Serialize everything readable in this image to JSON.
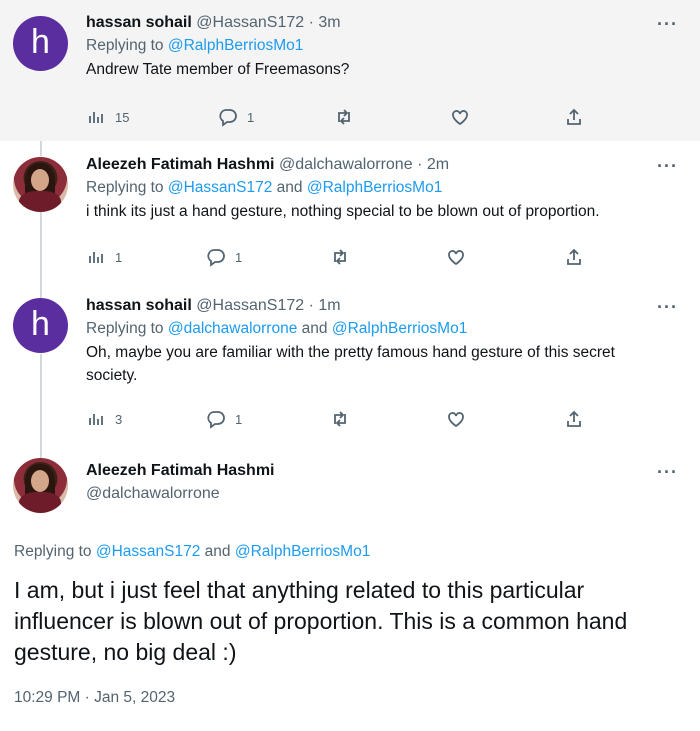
{
  "replies": [
    {
      "avatar_letter": "h",
      "name": "hassan sohail",
      "handle": "@HassanS172",
      "time": "· 3m",
      "replying_prefix": "Replying to ",
      "mentions": [
        "@RalphBerriosMo1"
      ],
      "mention_joiner": "",
      "text": "Andrew Tate member of Freemasons?",
      "stats": {
        "views": "15",
        "replies": "1",
        "retweets": "",
        "likes": ""
      }
    },
    {
      "avatar_letter": "",
      "name": "Aleezeh Fatimah Hashmi",
      "handle": "@dalchawalorrone",
      "time": "· 2m",
      "replying_prefix": "Replying to ",
      "mentions": [
        "@HassanS172",
        "@RalphBerriosMo1"
      ],
      "mention_joiner": " and ",
      "text": "i think its just a hand gesture, nothing special to be blown out of proportion.",
      "stats": {
        "views": "1",
        "replies": "1",
        "retweets": "",
        "likes": ""
      }
    },
    {
      "avatar_letter": "h",
      "name": "hassan sohail",
      "handle": "@HassanS172",
      "time": "· 1m",
      "replying_prefix": "Replying to ",
      "mentions": [
        "@dalchawalorrone",
        "@RalphBerriosMo1"
      ],
      "mention_joiner": " and ",
      "text": "Oh, maybe you are familiar with the pretty famous hand gesture of this secret society.",
      "stats": {
        "views": "3",
        "replies": "1",
        "retweets": "",
        "likes": ""
      }
    }
  ],
  "main_tweet": {
    "name": "Aleezeh Fatimah Hashmi",
    "handle": "@dalchawalorrone",
    "replying_prefix": "Replying to ",
    "mentions": [
      "@HassanS172",
      "@RalphBerriosMo1"
    ],
    "mention_joiner": " and ",
    "text": "I am, but i just feel that anything related to this particular influencer is blown out of proportion. This is a common hand gesture, no big deal :)",
    "timestamp": "10:29 PM · Jan 5, 2023"
  },
  "more_glyph": "···",
  "icons": {
    "views": "analytics-icon",
    "replies": "comment-icon",
    "retweets": "retweet-icon",
    "likes": "heart-icon",
    "share": "share-icon",
    "more": "more-icon"
  },
  "colors": {
    "accent": "#1d9bf0",
    "secondary_text": "#536471",
    "thread_line": "#cfd9de",
    "avatar_h": "#5b2ea0"
  }
}
